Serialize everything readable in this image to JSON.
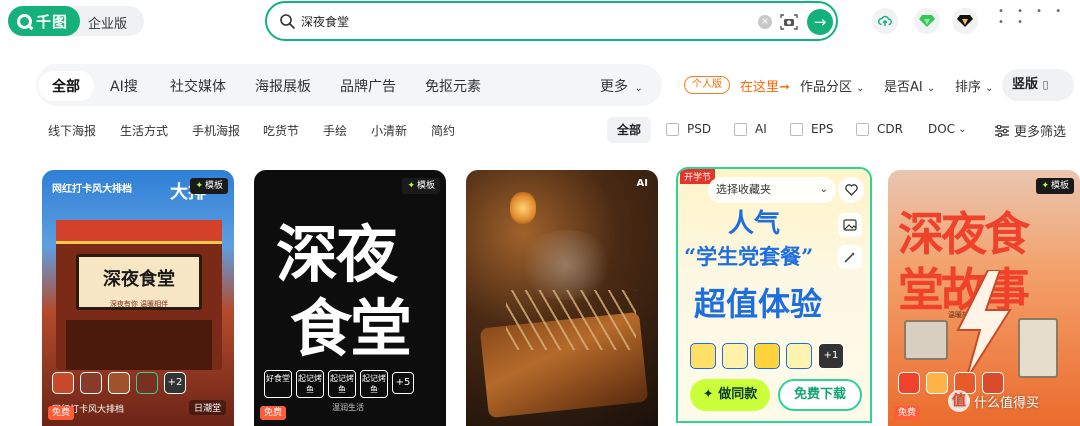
{
  "header": {
    "logo_text": "千图",
    "edition_label": "企业版",
    "search_value": "深夜食堂",
    "search_placeholder": "深夜食堂",
    "clear_symbol": "×",
    "go_symbol": "→",
    "menu_dots": "• • • • • •"
  },
  "categories": {
    "items": [
      "全部",
      "AI搜",
      "社交媒体",
      "海报展板",
      "品牌广告",
      "免抠元素"
    ],
    "more": "更多"
  },
  "filters": {
    "personal_badge": "个人版",
    "here_link": "在这里➞",
    "works_category": "作品分区",
    "is_ai": "是否AI",
    "sort": "排序",
    "orientation": "竖版"
  },
  "subcategories": [
    "线下海报",
    "生活方式",
    "手机海报",
    "吃货节",
    "手绘",
    "小清新",
    "简约"
  ],
  "formats": {
    "all": "全部",
    "items": [
      "PSD",
      "AI",
      "EPS",
      "CDR"
    ],
    "doc": "DOC",
    "more_filters": "更多筛选"
  },
  "cards": {
    "template_badge": "模板",
    "free_badge": "免费",
    "card1": {
      "brand_top": "网红打卡风大排档",
      "big_title": "大排",
      "sign": "深夜食堂",
      "sub_sign": "深夜有你 温暖相伴",
      "plus": "+2",
      "footer_left": "网红打卡风大排档",
      "footer_right": "日潮堂"
    },
    "card2": {
      "title_line1": "深夜",
      "title_line2": "食堂",
      "chips": [
        "好食堂",
        "起记烤鱼",
        "起记烤鱼",
        "起记烤鱼"
      ],
      "plus": "+5",
      "caption": "温润生活"
    },
    "card3": {
      "corner_label": "AI"
    },
    "card4": {
      "collect_placeholder": "选择收藏夹",
      "top_tag": "开学节",
      "line1": "人气",
      "line2": "“学生党套餐”",
      "line3": "超值体验",
      "plus": "+1",
      "same_button": "做同款",
      "download_button": "免费下载"
    },
    "card5": {
      "line1": "深夜食",
      "line2": "堂故事",
      "small_caption": "温暖故事正在上演"
    }
  },
  "watermark": {
    "icon": "值",
    "text": "什么值得买"
  },
  "colors": {
    "brand_green": "#14b27a",
    "accent_lime": "#caff3a",
    "orange": "#ff6a00"
  }
}
